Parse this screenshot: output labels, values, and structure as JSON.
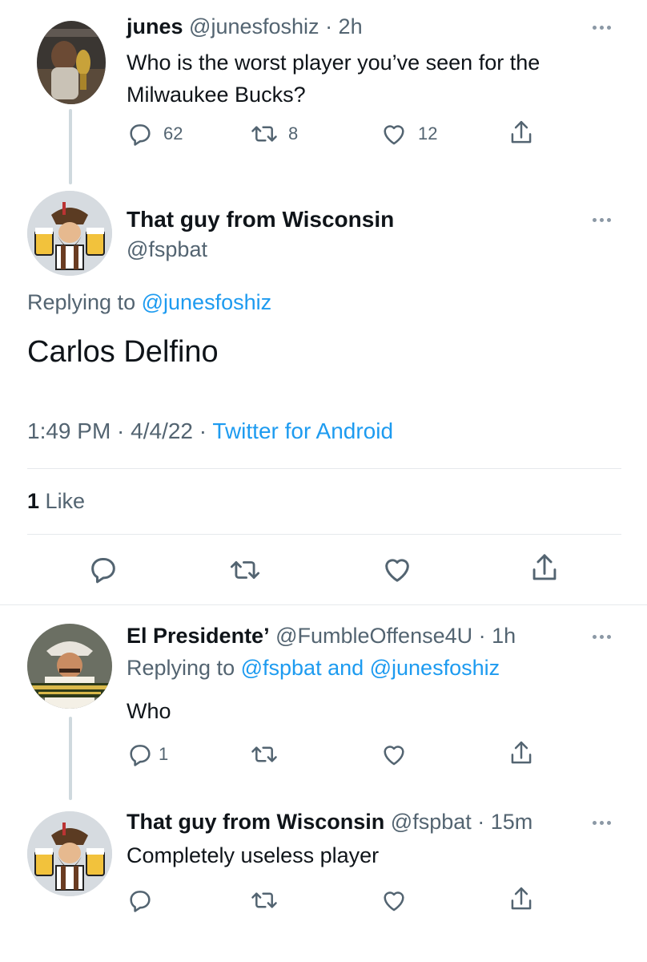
{
  "tweet1": {
    "name": "junes",
    "handle": "@junesfoshiz",
    "time": "· 2h",
    "text_line1": "Who is the worst player you’ve seen for the",
    "text_line2": "Milwaukee Bucks?",
    "replies": "62",
    "retweets": "8",
    "likes": "12",
    "icons": [
      "reply-icon",
      "retweet-icon",
      "like-icon",
      "share-icon"
    ]
  },
  "main_tweet": {
    "name": "That guy from Wisconsin",
    "handle": "@fspbat",
    "replying_prefix": "Replying to",
    "replying_to": "@junesfoshiz",
    "text": "Carlos Delfino",
    "timestamp": "1:49 PM · 4/4/22 ·",
    "source": "Twitter for Android",
    "likes_count": "1",
    "likes_label": "Like"
  },
  "reply1": {
    "name": "El Presidente’",
    "handle": "@FumbleOffense4U",
    "time": "· 1h",
    "replying_prefix": "Replying to",
    "replying_to": "@fspbat and @junesfoshiz",
    "text": "Who",
    "replies": "1"
  },
  "reply2": {
    "name": "That guy from Wisconsin",
    "handle": "@fspbat",
    "time": "· 15m",
    "text": "Completely useless player"
  },
  "colors": {
    "link": "#1d9bf0",
    "muted": "#536471",
    "divider": "#e6e9ec"
  }
}
